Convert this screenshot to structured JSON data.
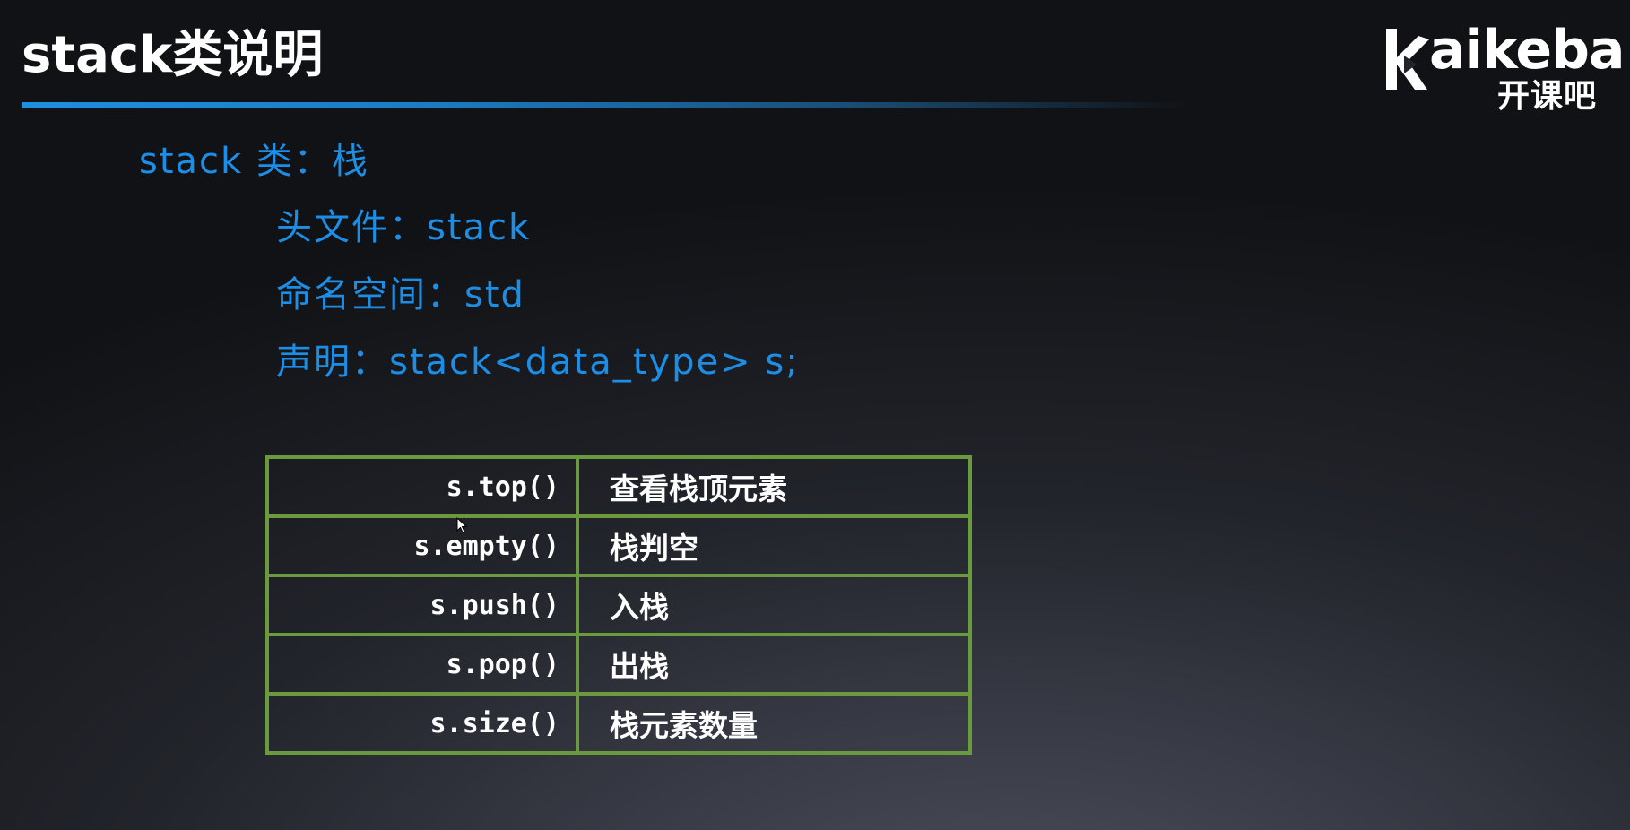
{
  "slide": {
    "title": "stack类说明"
  },
  "logo": {
    "wordmark": "kaikeba",
    "wordmark_tail": "aikeba",
    "chinese": "开课吧"
  },
  "content": {
    "heading": "stack 类：栈",
    "header_file": "头文件：stack",
    "namespace": "命名空间：std",
    "declaration": "声明：stack<data_type> s;"
  },
  "methods_table": {
    "rows": [
      {
        "method": "s.top()",
        "description": "查看栈顶元素"
      },
      {
        "method": "s.empty()",
        "description": "栈判空"
      },
      {
        "method": "s.push()",
        "description": "入栈"
      },
      {
        "method": "s.pop()",
        "description": "出栈"
      },
      {
        "method": "s.size()",
        "description": "栈元素数量"
      }
    ]
  },
  "colors": {
    "accent_blue": "#1d8ee6",
    "table_border": "#6b9a3e",
    "title_text": "#ffffff"
  },
  "icons": {
    "logo_mark": "kaikeba-k-play-icon",
    "cursor": "mouse-pointer-icon"
  }
}
